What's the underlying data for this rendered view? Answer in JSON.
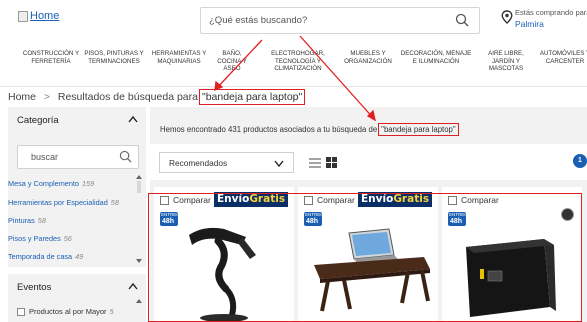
{
  "header": {
    "logo_text": "Home",
    "search_placeholder": "¿Qué estás buscando?",
    "location_label": "Estás comprando para",
    "location_city": "Palmira"
  },
  "categories": [
    "CONSTRUCCIÓN Y FERRETERÍA",
    "PISOS, PINTURAS Y TERMINACIONES",
    "HERRAMIENTAS Y MAQUINARIAS",
    "BAÑO, COCINA Y ASEO",
    "ELECTROHOGAR, TECNOLOGÍA Y CLIMATIZACIÓN",
    "MUEBLES Y ORGANIZACIÓN",
    "DECORACIÓN, MENAJE E ILUMINACIÓN",
    "AIRE LIBRE, JARDÍN Y MASCOTAS",
    "AUTOMÓVILES Y CARCENTER"
  ],
  "breadcrumb": {
    "home": "Home",
    "separator": ">",
    "results_prefix": "Resultados de búsqueda para",
    "query": "\"bandeja para laptop\""
  },
  "sidebar": {
    "category_title": "Categoría",
    "search_placeholder": "buscar",
    "facets": [
      {
        "label": "Mesa y Complemento",
        "count": "159"
      },
      {
        "label": "Herramientas por Especialidad",
        "count": "58"
      },
      {
        "label": "Pinturas",
        "count": "58"
      },
      {
        "label": "Pisos y Paredes",
        "count": "56"
      },
      {
        "label": "Temporada de casa",
        "count": "49"
      }
    ],
    "events_title": "Eventos",
    "events": [
      {
        "label": "Productos al por Mayor",
        "count": "5"
      }
    ]
  },
  "results": {
    "found_prefix": "Hemos encontrado 431 productos asociados a tu búsqueda de",
    "query": "\"bandeja para laptop\"",
    "sort_value": "Recomendados",
    "page_badge": "1"
  },
  "products": [
    {
      "compare_label": "Comparar",
      "shipping_badge": "Envío",
      "shipping_free": "Gratis",
      "delivery_small": "ENTREGA",
      "delivery_hours": "48h",
      "icon": "adjustable-laptop-stand-icon"
    },
    {
      "compare_label": "Comparar",
      "shipping_badge": "Envío",
      "shipping_free": "Gratis",
      "delivery_small": "ENTREGA",
      "delivery_hours": "48h",
      "icon": "laptop-bed-tray-icon"
    },
    {
      "compare_label": "Comparar",
      "delivery_small": "ENTREGA",
      "delivery_hours": "48h",
      "icon": "safe-box-icon"
    }
  ],
  "colors": {
    "accent": "#1a5fb4",
    "annotation": "#e02020",
    "shipping_bg": "#0a2f66",
    "shipping_free": "#f7d23a"
  }
}
